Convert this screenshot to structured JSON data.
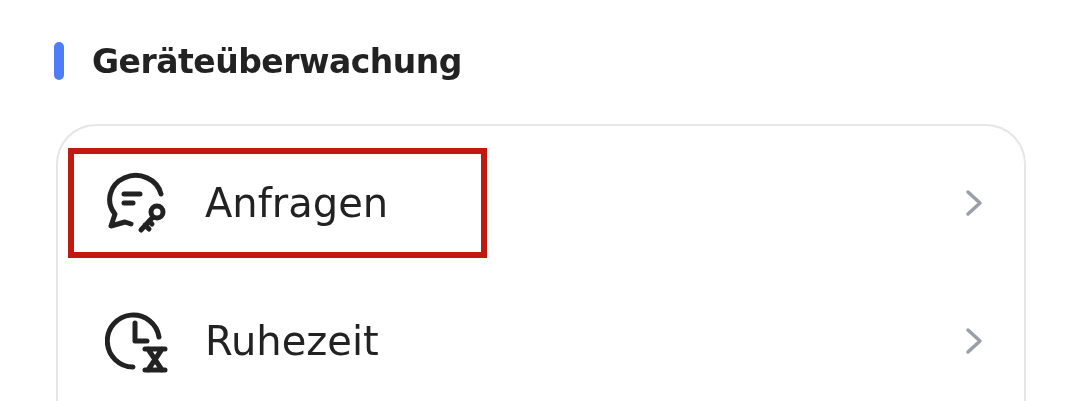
{
  "section": {
    "title": "Geräteüberwachung"
  },
  "items": [
    {
      "label": "Anfragen",
      "kind": "requests",
      "highlighted": true
    },
    {
      "label": "Ruhezeit",
      "kind": "downtime",
      "highlighted": false
    }
  ]
}
